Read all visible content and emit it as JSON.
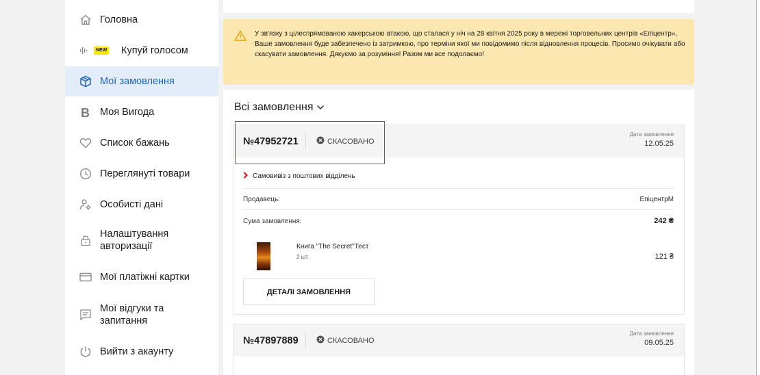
{
  "sidebar": {
    "items": [
      {
        "label": "Головна",
        "icon": "home-icon"
      },
      {
        "label": "Купуй голосом",
        "icon": "voice-icon",
        "badge": "NEW"
      },
      {
        "label": "Мої замовлення",
        "icon": "box-icon",
        "active": true
      },
      {
        "label": "Моя Вигода",
        "icon": "b-letter-icon"
      },
      {
        "label": "Список бажань",
        "icon": "heart-icon"
      },
      {
        "label": "Переглянуті товари",
        "icon": "clock-icon"
      },
      {
        "label": "Особисті дані",
        "icon": "user-gear-icon"
      },
      {
        "label": "Налаштування авторизації",
        "icon": "lock-icon"
      },
      {
        "label": "Мої платіжні картки",
        "icon": "card-icon"
      },
      {
        "label": "Мої відгуки та запитання",
        "icon": "chat-icon"
      },
      {
        "label": "Вийти з акаунту",
        "icon": "power-icon"
      }
    ]
  },
  "alert": {
    "text": "У зв'язку з цілеспрямованою хакерською атакою, що сталася у ніч на 28 квітня 2025 року в мережі торговельних центрів «Епіцентр», Ваше замовлення буде забезпечено із затримкою, про терміни якої ми повідомимо після відновлення процесів. Просимо очікувати або скасувати замовлення. Дякуємо за розуміння! Разом ми все подолаємо!",
    "icon": "warning-icon"
  },
  "orders": {
    "title": "Всі замовлення",
    "list": [
      {
        "number": "№47952721",
        "status": "СКАСОВАНО",
        "date_label": "Дата замовлення",
        "date": "12.05.25",
        "delivery": "Самовивіз з поштових відділень",
        "seller_label": "Продавець:",
        "seller": "ЕпіцентрМ",
        "sum_label": "Сума замовлення:",
        "sum": "242 ₴",
        "product": {
          "name": "Книга \"The Secret\"Тест",
          "qty": "2 шт.",
          "price": "121 ₴"
        },
        "details_button": "ДЕТАЛІ ЗАМОВЛЕННЯ"
      },
      {
        "number": "№47897889",
        "status": "СКАСОВАНО",
        "date_label": "Дата замовлення",
        "date": "09.05.25"
      }
    ]
  },
  "colors": {
    "accent": "#1f62b8",
    "active_bg": "#e3edf9",
    "alert_bg": "#fde7b0",
    "highlight": "#d9302c",
    "brand_red": "#e3000f"
  }
}
